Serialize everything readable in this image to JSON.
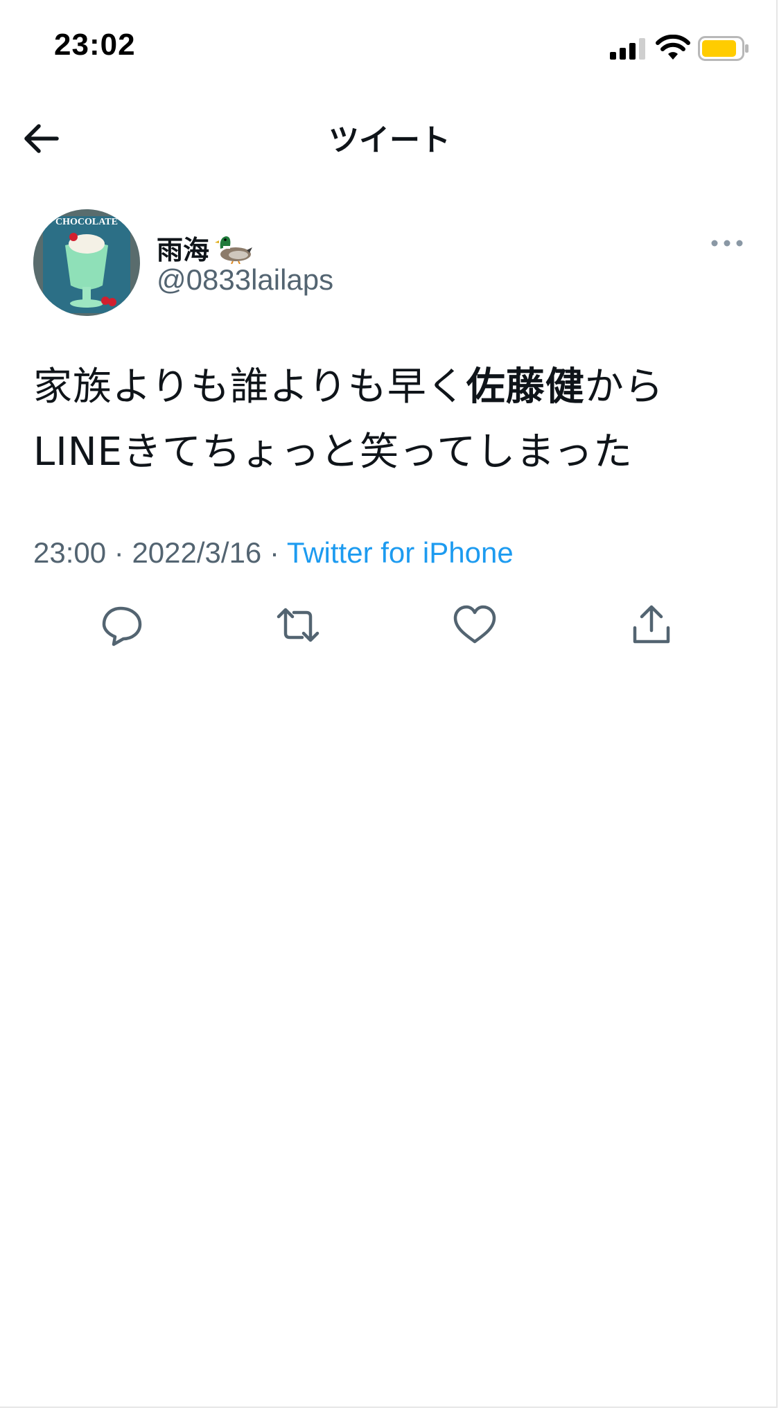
{
  "status_bar": {
    "time": "23:02",
    "signal_icon": "cellular-signal-icon",
    "wifi_icon": "wifi-icon",
    "battery_icon": "battery-icon",
    "battery_color": "#ffcc00"
  },
  "header": {
    "back_icon": "arrow-left-icon",
    "title": "ツイート"
  },
  "tweet": {
    "author": {
      "display_name": "雨海",
      "name_emoji_icon": "duck-icon",
      "handle": "@0833lailaps",
      "avatar_text": "CHOCOLATE"
    },
    "more_icon": "more-horizontal-icon",
    "text": {
      "line1_a": "家族よりも誰よりも早く",
      "line1_bold": "佐藤健",
      "line1_b": "から",
      "line2": "LINEきてちょっと笑ってしまった"
    },
    "time": "23:00",
    "separator": " · ",
    "date": "2022/3/16",
    "source": "Twitter for iPhone"
  },
  "actions": [
    {
      "name": "reply",
      "icon": "reply-icon"
    },
    {
      "name": "retweet",
      "icon": "retweet-icon"
    },
    {
      "name": "like",
      "icon": "heart-icon"
    },
    {
      "name": "share",
      "icon": "share-icon"
    }
  ],
  "colors": {
    "text": "#0f1419",
    "secondary": "#536471",
    "link": "#1d9bf0",
    "icon": "#536471"
  }
}
